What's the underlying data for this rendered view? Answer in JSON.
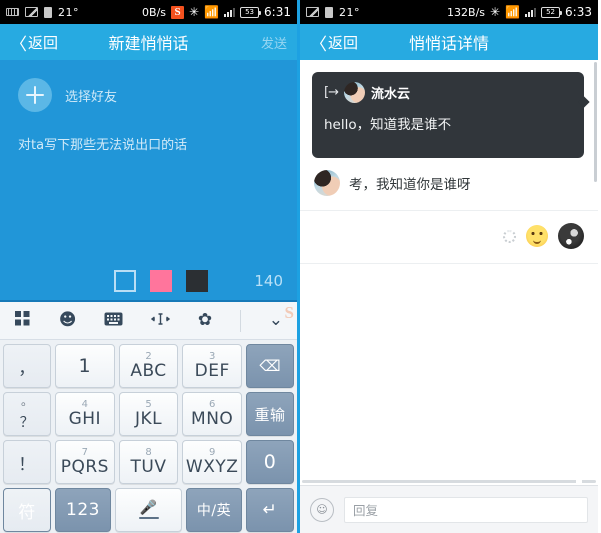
{
  "left": {
    "statusbar": {
      "icons_left": [
        "keyboard-icon",
        "photo-icon",
        "document-icon"
      ],
      "temperature": "21°",
      "network_speed": "0B/s",
      "app_badge": "S",
      "bluetooth": "bluetooth-icon",
      "wifi": "wifi-icon",
      "signal": "signal-icon",
      "battery_level": "53",
      "time": "6:31"
    },
    "titlebar": {
      "back_label": "返回",
      "title": "新建悄悄话",
      "action_label": "发送"
    },
    "compose": {
      "pick_friend_label": "选择好友",
      "hint": "对ta写下那些无法说出口的话",
      "char_count": "140",
      "swatch_colors": [
        "#b9def5",
        "#ff759c",
        "#2b2f33"
      ],
      "background_color": "#2196d8"
    },
    "keyboard": {
      "toolbar": [
        "apps-grid-icon",
        "emoji-icon",
        "keyboard-icon",
        "cursor-move-icon",
        "gear-icon",
        "chevron-down-icon"
      ],
      "watermark": "S",
      "rows": [
        [
          {
            "name": "key-comma",
            "num": "",
            "alpha": "，",
            "type": "punct"
          },
          {
            "name": "key-1",
            "num": "",
            "alpha": "1",
            "type": "normal"
          },
          {
            "name": "key-2",
            "num": "2",
            "alpha": "ABC",
            "type": "normal"
          },
          {
            "name": "key-3",
            "num": "3",
            "alpha": "DEF",
            "type": "normal"
          },
          {
            "name": "key-backspace",
            "num": "",
            "alpha": "⌫",
            "type": "fn"
          }
        ],
        [
          {
            "name": "key-period-question",
            "num": "。",
            "alpha": "？",
            "type": "punct"
          },
          {
            "name": "key-4",
            "num": "4",
            "alpha": "GHI",
            "type": "normal"
          },
          {
            "name": "key-5",
            "num": "5",
            "alpha": "JKL",
            "type": "normal"
          },
          {
            "name": "key-6",
            "num": "6",
            "alpha": "MNO",
            "type": "normal"
          },
          {
            "name": "key-redo",
            "num": "",
            "alpha": "重输",
            "type": "fn"
          }
        ],
        [
          {
            "name": "key-exclamation",
            "num": "",
            "alpha": "！",
            "type": "punct"
          },
          {
            "name": "key-7",
            "num": "7",
            "alpha": "PQRS",
            "type": "normal"
          },
          {
            "name": "key-8",
            "num": "8",
            "alpha": "TUV",
            "type": "normal"
          },
          {
            "name": "key-9",
            "num": "9",
            "alpha": "WXYZ",
            "type": "normal"
          },
          {
            "name": "key-0",
            "num": "",
            "alpha": "0",
            "type": "fn"
          }
        ],
        [
          {
            "name": "key-symbols",
            "num": "",
            "alpha": "符",
            "type": "fn"
          },
          {
            "name": "key-123",
            "num": "",
            "alpha": "123",
            "type": "fn"
          },
          {
            "name": "key-space-mic",
            "num": "",
            "alpha": "mic-icon",
            "type": "normal"
          },
          {
            "name": "key-lang-toggle",
            "num": "",
            "alpha": "中/英",
            "type": "fn"
          },
          {
            "name": "key-enter",
            "num": "",
            "alpha": "↵",
            "type": "fn"
          }
        ]
      ]
    }
  },
  "right": {
    "statusbar": {
      "icons_left": [
        "photo-icon",
        "document-icon"
      ],
      "temperature": "21°",
      "network_speed": "132B/s",
      "bluetooth": "bluetooth-icon",
      "wifi": "wifi-icon",
      "signal": "signal-icon",
      "battery_level": "52",
      "time": "6:33"
    },
    "titlebar": {
      "back_label": "返回",
      "title": "悄悄话详情"
    },
    "messages": [
      {
        "type": "secret-card",
        "icon": "arrow-enter-icon",
        "sender": "流水云",
        "text": "hello，知道我是谁不"
      },
      {
        "type": "reply",
        "sender_avatar": "avatar-girl",
        "text": "考，我知道你是谁呀"
      },
      {
        "type": "sticker",
        "status": "sending-spinner",
        "sticker": "smiley-emoji",
        "sender_avatar": "avatar-dark"
      }
    ],
    "input_bar": {
      "emoji_button": "emoji-icon",
      "placeholder": "回复"
    }
  }
}
